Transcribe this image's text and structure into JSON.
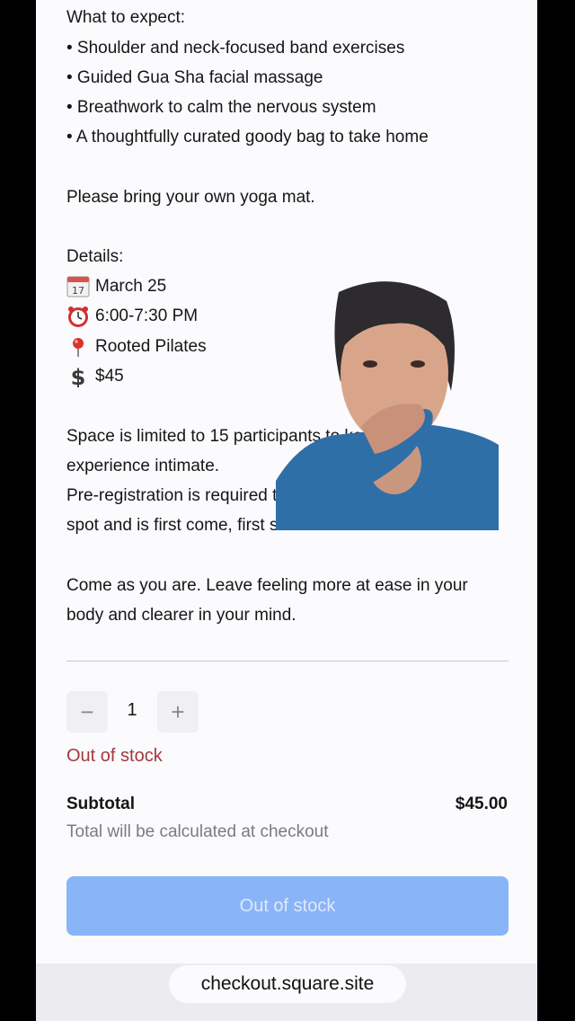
{
  "description": {
    "heading": "What to expect:",
    "bullets": [
      "• Shoulder and neck-focused band exercises",
      "• Guided Gua Sha facial massage",
      "• Breathwork to calm the nervous system",
      "• A thoughtfully curated goody bag to take home"
    ],
    "bring_note": "Please bring your own yoga mat.",
    "details_heading": "Details:",
    "details": {
      "date": "March 25",
      "time": "6:00-7:30 PM",
      "location": "Rooted Pilates",
      "price": "$45"
    },
    "calendar_badge_number": "17",
    "limit_line_1": "Space is limited to 15 participants to keep the",
    "limit_line_2": "experience intimate.",
    "prereg_line_1": "Pre-registration is required to reserve your",
    "prereg_line_2": "spot and is first come, first served.",
    "closing_line_1": "Come as you are. Leave feeling more at ease in your",
    "closing_line_2": "body and clearer in your mind."
  },
  "quantity": {
    "decrement_symbol": "−",
    "increment_symbol": "+",
    "value": "1"
  },
  "stock_status": "Out of stock",
  "subtotal": {
    "label": "Subtotal",
    "value": "$45.00",
    "note": "Total will be calculated at checkout"
  },
  "checkout_button_label": "Out of stock",
  "browser": {
    "url": "checkout.square.site"
  },
  "icons": {
    "calendar": "calendar-icon",
    "alarm": "alarm-clock-icon",
    "pin": "map-pin-icon",
    "dollar": "dollar-sign-icon"
  },
  "colors": {
    "out_of_stock_text": "#a13a3f",
    "disabled_button": "#8ab4f8",
    "page_background": "#fbfafd"
  }
}
